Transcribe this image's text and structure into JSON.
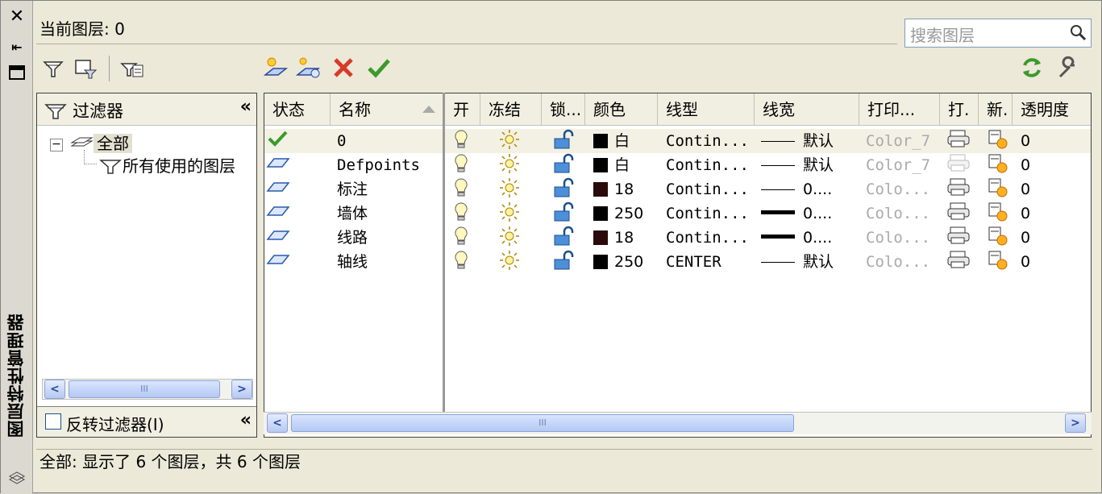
{
  "window": {
    "vertical_title": "图层特性管理器",
    "current_layer": "当前图层: 0",
    "search_placeholder": "搜索图层"
  },
  "filter_panel": {
    "title": "过滤器",
    "tree": [
      {
        "label": "全部",
        "expanded": true
      },
      {
        "label": "所有使用的图层"
      }
    ],
    "invert_label": "反转过滤器(I)"
  },
  "grid": {
    "columns": [
      "状态",
      "名称",
      "开",
      "冻结",
      "锁...",
      "颜色",
      "线型",
      "线宽",
      "打印...",
      "打.",
      "新.",
      "透明度"
    ],
    "rows": [
      {
        "status": "current",
        "name": "0",
        "color_swatch": "#000000",
        "color": "白",
        "linetype": "Contin...",
        "lineweight": "默认",
        "lw_thick": false,
        "plot_style": "Color_7",
        "plot_dim": false,
        "transparency": "0"
      },
      {
        "status": "layer",
        "name": "Defpoints",
        "color_swatch": "#000000",
        "color": "白",
        "linetype": "Contin...",
        "lineweight": "默认",
        "lw_thick": false,
        "plot_style": "Color_7",
        "plot_dim": true,
        "transparency": "0"
      },
      {
        "status": "layer",
        "name": "标注",
        "color_swatch": "#2a0a0a",
        "color": "18",
        "linetype": "Contin...",
        "lineweight": "0....",
        "lw_thick": false,
        "plot_style": "Colo...",
        "plot_dim": false,
        "transparency": "0"
      },
      {
        "status": "layer",
        "name": "墙体",
        "color_swatch": "#000000",
        "color": "250",
        "linetype": "Contin...",
        "lineweight": "0....",
        "lw_thick": true,
        "plot_style": "Colo...",
        "plot_dim": false,
        "transparency": "0"
      },
      {
        "status": "layer",
        "name": "线路",
        "color_swatch": "#2a0a0a",
        "color": "18",
        "linetype": "Contin...",
        "lineweight": "0....",
        "lw_thick": true,
        "plot_style": "Colo...",
        "plot_dim": false,
        "transparency": "0"
      },
      {
        "status": "layer",
        "name": "轴线",
        "color_swatch": "#000000",
        "color": "250",
        "linetype": "CENTER",
        "lineweight": "默认",
        "lw_thick": false,
        "plot_style": "Colo...",
        "plot_dim": false,
        "transparency": "0"
      }
    ]
  },
  "status_bar": "全部: 显示了 6 个图层，共 6 个图层",
  "scroll_grip": "III",
  "colors": {
    "accent_blue": "#8ba3d6",
    "current_check": "#3c9a2a",
    "delete_red": "#d83a2a"
  }
}
